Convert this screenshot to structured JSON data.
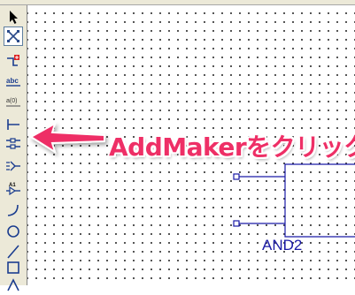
{
  "toolbar": {
    "tools": [
      {
        "name": "select-pointer-tool",
        "icon": "arrow-pointer-icon"
      },
      {
        "name": "zoom-region-tool",
        "icon": "zoom-region-icon",
        "selected": true
      },
      {
        "name": "symbol-tool",
        "icon": "symbol-insert-icon"
      },
      {
        "name": "text-tool",
        "icon": "text-abc-icon",
        "label": "abc"
      },
      {
        "name": "bus-label-tool",
        "icon": "bus-label-icon",
        "label": "a(0)"
      },
      {
        "name": "pin-tool",
        "icon": "pin-icon"
      },
      {
        "name": "add-marker-tool",
        "icon": "add-marker-icon"
      },
      {
        "name": "io-port-tool",
        "icon": "io-port-icon"
      },
      {
        "name": "attribute-tool",
        "icon": "attribute-icon",
        "label": "A1"
      },
      {
        "name": "arc-tool",
        "icon": "arc-icon"
      },
      {
        "name": "circle-tool",
        "icon": "circle-icon"
      },
      {
        "name": "line-tool",
        "icon": "line-icon"
      },
      {
        "name": "rectangle-tool",
        "icon": "rectangle-icon"
      },
      {
        "name": "polygon-tool",
        "icon": "polygon-icon"
      }
    ]
  },
  "callout": {
    "text": "AddMakerをクリック",
    "color": "#ee2f66"
  },
  "gate": {
    "label": "AND2",
    "color": "#1a1aa6"
  }
}
